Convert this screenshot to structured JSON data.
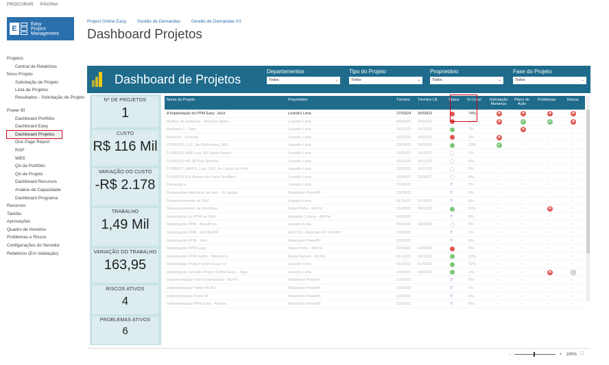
{
  "topmenu": [
    "PROCURAR",
    "PÁGINA"
  ],
  "logo": {
    "letter": "E",
    "line1": "Easy",
    "line2": "Project",
    "line3": "Management"
  },
  "breadcrumbs": [
    "Project Online Easy",
    "Gestão de Demandas",
    "Gestão de Demandas V2"
  ],
  "page_title": "Dashboard Projetos",
  "nav": [
    {
      "label": "Projetos",
      "level": 0
    },
    {
      "label": "Central de Relatórios",
      "level": 1
    },
    {
      "label": "Novo Projeto",
      "level": 0
    },
    {
      "label": "Solicitação de Projeto",
      "level": 1
    },
    {
      "label": "Lista de Projetos",
      "level": 1
    },
    {
      "label": "Resultados - Solicitação de Projeto",
      "level": 1,
      "two": true
    },
    {
      "label": "Power BI",
      "level": 0
    },
    {
      "label": "Dashboard Portfólio",
      "level": 1
    },
    {
      "label": "Dashboard Easy",
      "level": 1
    },
    {
      "label": "Dashboard Projetos",
      "level": 1,
      "active": true
    },
    {
      "label": "One Page Report",
      "level": 1
    },
    {
      "label": "RAP",
      "level": 1
    },
    {
      "label": "WBS",
      "level": 1
    },
    {
      "label": "QA de Portfólio",
      "level": 1
    },
    {
      "label": "QA de Projeto",
      "level": 1
    },
    {
      "label": "Dashboard Recursos",
      "level": 1
    },
    {
      "label": "Análise de Capacidade",
      "level": 1
    },
    {
      "label": "Dashboard Programa",
      "level": 1
    },
    {
      "label": "Recursos",
      "level": 0
    },
    {
      "label": "Tarefas",
      "level": 0
    },
    {
      "label": "Aprovações",
      "level": 0
    },
    {
      "label": "Quadro de Horários",
      "level": 0
    },
    {
      "label": "Problemas e Riscos",
      "level": 0
    },
    {
      "label": "Configurações do Servidor",
      "level": 0
    },
    {
      "label": "Relatórios (Em Validação)",
      "level": 0
    }
  ],
  "report": {
    "title": "Dashboard de Projetos",
    "filters": [
      {
        "label": "Departamentos",
        "value": "Todos"
      },
      {
        "label": "Tipo do Projeto",
        "value": "Todos"
      },
      {
        "label": "Proprietário",
        "value": "Todos"
      },
      {
        "label": "Fase do Projeto",
        "value": "Todos"
      }
    ],
    "cards": [
      {
        "label": "Nº DE PROJETOS",
        "value": "1"
      },
      {
        "label": "CUSTO",
        "value": "R$ 116 Mil"
      },
      {
        "label": "VARIAÇÃO DO CUSTO",
        "value": "-R$ 2.178"
      },
      {
        "label": "TRABALHO",
        "value": "1,49 Mil"
      },
      {
        "label": "VARIAÇÃO DO TRABALHO",
        "value": "163,95"
      },
      {
        "label": "RISCOS ATIVOS",
        "value": "4"
      },
      {
        "label": "PROBLEMAS ATIVOS",
        "value": "6"
      }
    ],
    "columns": [
      "Nome do Projeto",
      "Proprietário",
      "Término",
      "Término LB.",
      "Status",
      "% Concl.",
      "Solicitação Mudança",
      "Plano de Ação",
      "Problemas",
      "Riscos"
    ],
    "rows": [
      {
        "n": "A Implantação do PPM Easy - Azul",
        "o": "Leandro Lima",
        "t": "27/03/24",
        "lb": "30/09/22",
        "s": "red",
        "p": "74%",
        "sm": "x",
        "pa": "x",
        "pr": "x",
        "ri": "x"
      },
      {
        "n": "Análise do ambiente - BlueFint Alpha",
        "o": "Leandro Lima",
        "t": "06/09/22",
        "lb": "06/09/22",
        "s": "red",
        "p": "17%",
        "sm": "x",
        "pa": "g",
        "pr": "g",
        "ri": "x"
      },
      {
        "n": "Auditoria 1 - Tigre",
        "o": "Leandro Lima",
        "t": "16/11/23",
        "lb": "04/12/23",
        "s": "green",
        "p": "7%",
        "sm": "",
        "pa": "x",
        "pr": "",
        "ri": ""
      },
      {
        "n": "BlueFlint - Cristalia",
        "o": "Leandro Lima",
        "t": "16/02/22",
        "lb": "16/02/22",
        "s": "red",
        "p": "3%",
        "sm": "x",
        "pa": "",
        "pr": "",
        "ri": ""
      },
      {
        "n": "D1006053_DJC_Av Barbosnea_066",
        "o": "Leandro Lima",
        "t": "20/09/20",
        "lb": "20/09/20",
        "s": "green",
        "p": "20%",
        "sm": "g",
        "pa": "",
        "pr": "",
        "ri": ""
      },
      {
        "n": "D1006133 AMP Loja 185 Santo Amaro",
        "o": "Leandro Lima",
        "t": "15/03/27",
        "lb": "16/03/27",
        "s": "ring",
        "p": "0%",
        "sm": "",
        "pa": "",
        "pr": "",
        "ri": ""
      },
      {
        "n": "D1005291 NE SP Rua Sinimbu",
        "o": "Leandro Lima",
        "t": "16/12/20",
        "lb": "16/12/20",
        "s": "ring",
        "p": "0%",
        "sm": "",
        "pa": "",
        "pr": "",
        "ri": ""
      },
      {
        "n": "D1006017_AMPE_Loja 1002_Av Carlos de Freit",
        "o": "Leandro Lima",
        "t": "16/07/22",
        "lb": "16/07/22",
        "s": "ring",
        "p": "0%",
        "sm": "",
        "pa": "",
        "pr": "",
        "ri": ""
      },
      {
        "n": "D1006003 Rui Moraes Av Paulo Brolllard",
        "o": "Leandro Lima",
        "t": "15/04/27",
        "lb": "15/04/27",
        "s": "ring",
        "p": "0%",
        "sm": "",
        "pa": "",
        "pr": "",
        "ri": ""
      },
      {
        "n": "Demanda x",
        "o": "Leandro Lima",
        "t": "07/06/22",
        "lb": "",
        "s": "q",
        "p": "0%",
        "sm": "",
        "pa": "",
        "pr": "",
        "ri": ""
      },
      {
        "n": "Desenvolver Aplicativo de rede - Sr Saúde",
        "o": "Relatórios PowerBI",
        "t": "23/09/22",
        "lb": "",
        "s": "q",
        "p": "0%",
        "sm": "",
        "pa": "",
        "pr": "",
        "ri": ""
      },
      {
        "n": "Desenvolvimento de BSC",
        "o": "Leandro Lima",
        "t": "01/10/22",
        "lb": "01/10/22",
        "s": "q",
        "p": "0%",
        "sm": "",
        "pa": "",
        "pr": "",
        "ri": ""
      },
      {
        "n": "Desenvolvimento de Workflow",
        "o": "Fabio Pinho - MLPro",
        "t": "21/09/22",
        "lb": "30/01/23",
        "s": "green",
        "p": "60%",
        "sm": "",
        "pa": "",
        "pr": "x",
        "ri": ""
      },
      {
        "n": "Implantação do PPM na SSA",
        "o": "Eduardo Colares - MLPro",
        "t": "24/09/22",
        "lb": "",
        "s": "q",
        "p": "0%",
        "sm": "",
        "pa": "",
        "pr": "",
        "ri": ""
      },
      {
        "n": "Implantação PPM - BrasilPrev",
        "o": "Leandro Lima",
        "t": "09/09/09",
        "lb": "09/09/29",
        "s": "ring",
        "p": "0%",
        "sm": "",
        "pa": "",
        "pr": "",
        "ri": ""
      },
      {
        "n": "Implantação PPM - HCFMUSP",
        "o": "EASY20 - Ablimael HC FMUSP",
        "t": "24/09/21",
        "lb": "",
        "s": "q",
        "p": "0%",
        "sm": "",
        "pa": "",
        "pr": "",
        "ri": ""
      },
      {
        "n": "Implantação PPM - Sesi",
        "o": "Relatórios PowerBI",
        "t": "23/09/22",
        "lb": "",
        "s": "q",
        "p": "0%",
        "sm": "",
        "pa": "",
        "pr": "",
        "ri": ""
      },
      {
        "n": "Implantação PPM Easy",
        "o": "Fabio Pinho - MLPro",
        "t": "02/08/22",
        "lb": "14/09/22",
        "s": "red",
        "p": "0%",
        "sm": "",
        "pa": "",
        "pr": "",
        "ri": ""
      },
      {
        "n": "Implantação PPM Inglês - Telefonica",
        "o": "Mariel Ramos - MLPro",
        "t": "01/12/21",
        "lb": "14/12/21",
        "s": "green",
        "p": "20%",
        "sm": "",
        "pa": "",
        "pr": "",
        "ri": ""
      },
      {
        "n": "Implantação Project Online Easy v2",
        "o": "Leandro Lima",
        "t": "01/03/22",
        "lb": "01/03/22",
        "s": "green",
        "p": "32%",
        "sm": "",
        "pa": "",
        "pr": "",
        "ri": ""
      },
      {
        "n": "Implantação Solução Project Online Easy - Tigre",
        "o": "Leandro Lima",
        "t": "24/09/21",
        "lb": "24/09/21",
        "s": "green",
        "p": "1%",
        "sm": "",
        "pa": "",
        "pr": "x",
        "ri": "o"
      },
      {
        "n": "Implementação Fluxo Empresarial - MLPro",
        "o": "Relatórios PowerBI",
        "t": "23/09/22",
        "lb": "",
        "s": "q",
        "p": "0%",
        "sm": "",
        "pa": "",
        "pr": "",
        "ri": ""
      },
      {
        "n": "Implementação Painel MLPro",
        "o": "Relatórios PowerBI",
        "t": "23/09/22",
        "lb": "",
        "s": "q",
        "p": "0%",
        "sm": "",
        "pa": "",
        "pr": "",
        "ri": ""
      },
      {
        "n": "Implementação Power B",
        "o": "Relatórios PowerBI",
        "t": "23/09/22",
        "lb": "",
        "s": "q",
        "p": "0%",
        "sm": "",
        "pa": "",
        "pr": "",
        "ri": ""
      },
      {
        "n": "Implementação PPM Easy - Arcelor",
        "o": "Relatórios PowerBI",
        "t": "23/09/22",
        "lb": "",
        "s": "q",
        "p": "0%",
        "sm": "",
        "pa": "",
        "pr": "",
        "ri": ""
      }
    ]
  },
  "zoom": {
    "minus": "-",
    "plus": "+",
    "level": "100%"
  },
  "colors": {
    "banner": "#1e6b8c",
    "cards_bg": "#c9e3e6",
    "highlight": "#d0021b",
    "status_red": "#e0554d",
    "status_green": "#7cc67a"
  }
}
